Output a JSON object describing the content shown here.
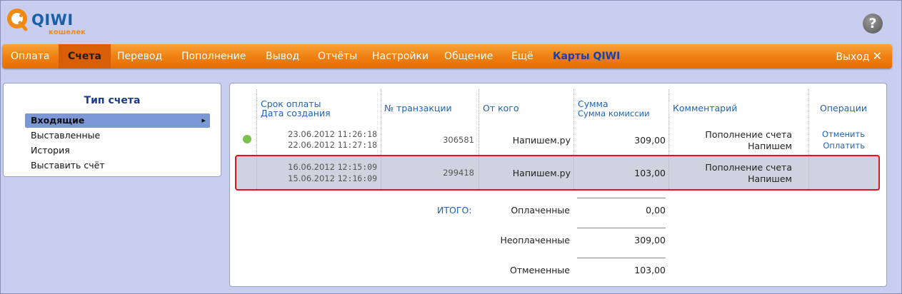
{
  "logo": {
    "word": "QIWI",
    "sub": "кошелек"
  },
  "help_label": "?",
  "nav": {
    "items": [
      "Оплата",
      "Счета",
      "Перевод",
      "Пополнение",
      "Вывод",
      "Отчёты",
      "Настройки",
      "Общение",
      "Ещё",
      "Карты QIWI"
    ],
    "active": "Счета",
    "exit": "Выход",
    "exit_icon": "✕"
  },
  "sidebar": {
    "title": "Тип счета",
    "items": [
      "Входящие",
      "Выставленные",
      "История",
      "Выставить счёт"
    ],
    "selected": "Входящие"
  },
  "table": {
    "headers": {
      "due": "Срок оплаты",
      "created": "Дата создания",
      "txn": "№ транзакции",
      "from": "От кого",
      "sum": "Сумма",
      "fee": "Сумма комиссии",
      "comment": "Комментарий",
      "ops": "Операции"
    },
    "rows": [
      {
        "status": "green",
        "date1": "23.06.2012",
        "time1": "11:26:18",
        "date2": "22.06.2012",
        "time2": "11:27:18",
        "txn": "306581",
        "from": "Напишем.ру",
        "sum": "309,00",
        "comment1": "Пополнение счета",
        "comment2": "Напишем",
        "op1": "Отменить",
        "op2": "Оплатить"
      },
      {
        "status": "",
        "date1": "16.06.2012",
        "time1": "12:15:09",
        "date2": "15.06.2012",
        "time2": "12:16:09",
        "txn": "299418",
        "from": "Напишем.ру",
        "sum": "103,00",
        "comment1": "Пополнение счета",
        "comment2": "Напишем",
        "op1": "",
        "op2": ""
      }
    ]
  },
  "totals": {
    "label": "ИТОГО:",
    "paid_label": "Оплаченные",
    "paid": "0,00",
    "unpaid_label": "Неоплаченные",
    "unpaid": "309,00",
    "cancelled_label": "Отмененные",
    "cancelled": "103,00"
  },
  "colors": {
    "nav_orange": "#ef7e0f",
    "link_blue": "#1d64b8",
    "highlight_red": "#e1141b",
    "status_green": "#7bc04a"
  }
}
